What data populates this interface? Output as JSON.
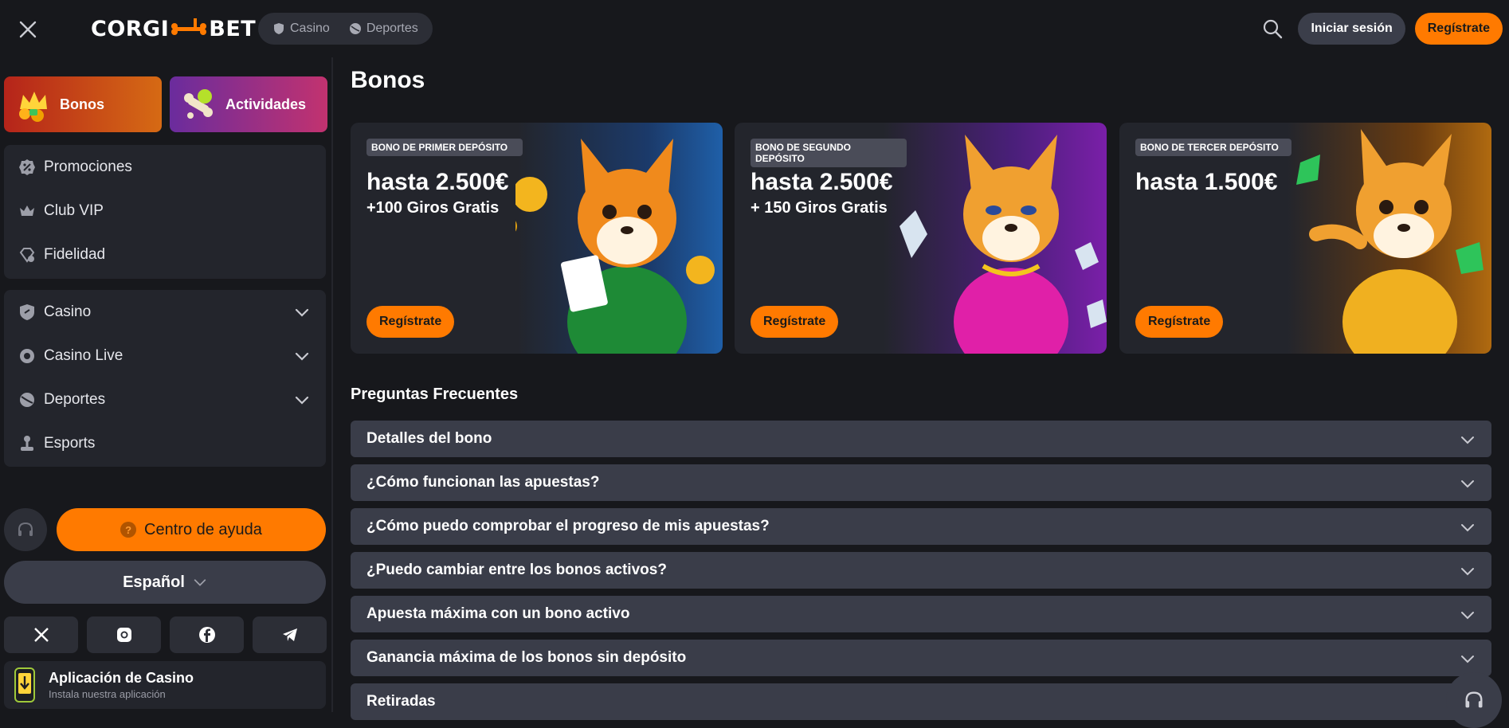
{
  "header": {
    "logo_left": "CORGI",
    "logo_right": "BET",
    "nav": [
      {
        "label": "Casino",
        "icon": "shield-icon"
      },
      {
        "label": "Deportes",
        "icon": "ball-icon"
      }
    ],
    "login_label": "Iniciar sesión",
    "register_label": "Regístrate"
  },
  "sidebar": {
    "tiles": [
      {
        "label": "Bonos",
        "icon": "crown-icon"
      },
      {
        "label": "Actividades",
        "icon": "bone-icon"
      }
    ],
    "group1": [
      {
        "label": "Promociones",
        "icon": "percent-badge-icon"
      },
      {
        "label": "Club VIP",
        "icon": "crown-icon"
      },
      {
        "label": "Fidelidad",
        "icon": "diamond-icon"
      }
    ],
    "group2": [
      {
        "label": "Casino",
        "icon": "shield-icon",
        "expandable": true
      },
      {
        "label": "Casino Live",
        "icon": "live-icon",
        "expandable": true
      },
      {
        "label": "Deportes",
        "icon": "ball-icon",
        "expandable": true
      },
      {
        "label": "Esports",
        "icon": "joystick-icon",
        "expandable": false
      }
    ],
    "help_label": "Centro de ayuda",
    "language": "Español",
    "socials": [
      "x-icon",
      "instagram-icon",
      "facebook-icon",
      "telegram-icon"
    ],
    "app": {
      "title": "Aplicación de Casino",
      "subtitle": "Instala nuestra aplicación"
    }
  },
  "main": {
    "title": "Bonos",
    "cards": [
      {
        "badge": "Bono de primer depósito",
        "amount": "hasta 2.500€",
        "spins": "+100 Giros Gratis",
        "button": "Regístrate",
        "accent": "#1f5fa8"
      },
      {
        "badge": "Bono de segundo depósito",
        "amount": "hasta 2.500€",
        "spins": "+ 150 Giros Gratis",
        "button": "Regístrate",
        "accent": "#7a1fa8"
      },
      {
        "badge": "Bono de tercer depósito",
        "amount": "hasta 1.500€",
        "spins": "",
        "button": "Regístrate",
        "accent": "#b06a10"
      }
    ],
    "faq_title": "Preguntas Frecuentes",
    "faq": [
      "Detalles del bono",
      "¿Cómo funcionan las apuestas?",
      "¿Cómo puedo comprobar el progreso de mis apuestas?",
      "¿Puedo cambiar entre los bonos activos?",
      "Apuesta máxima con un bono activo",
      "Ganancia máxima de los bonos sin depósito",
      "Retiradas"
    ]
  },
  "colors": {
    "accent": "#ff7a00",
    "background": "#17181c",
    "panel": "#23252c"
  }
}
